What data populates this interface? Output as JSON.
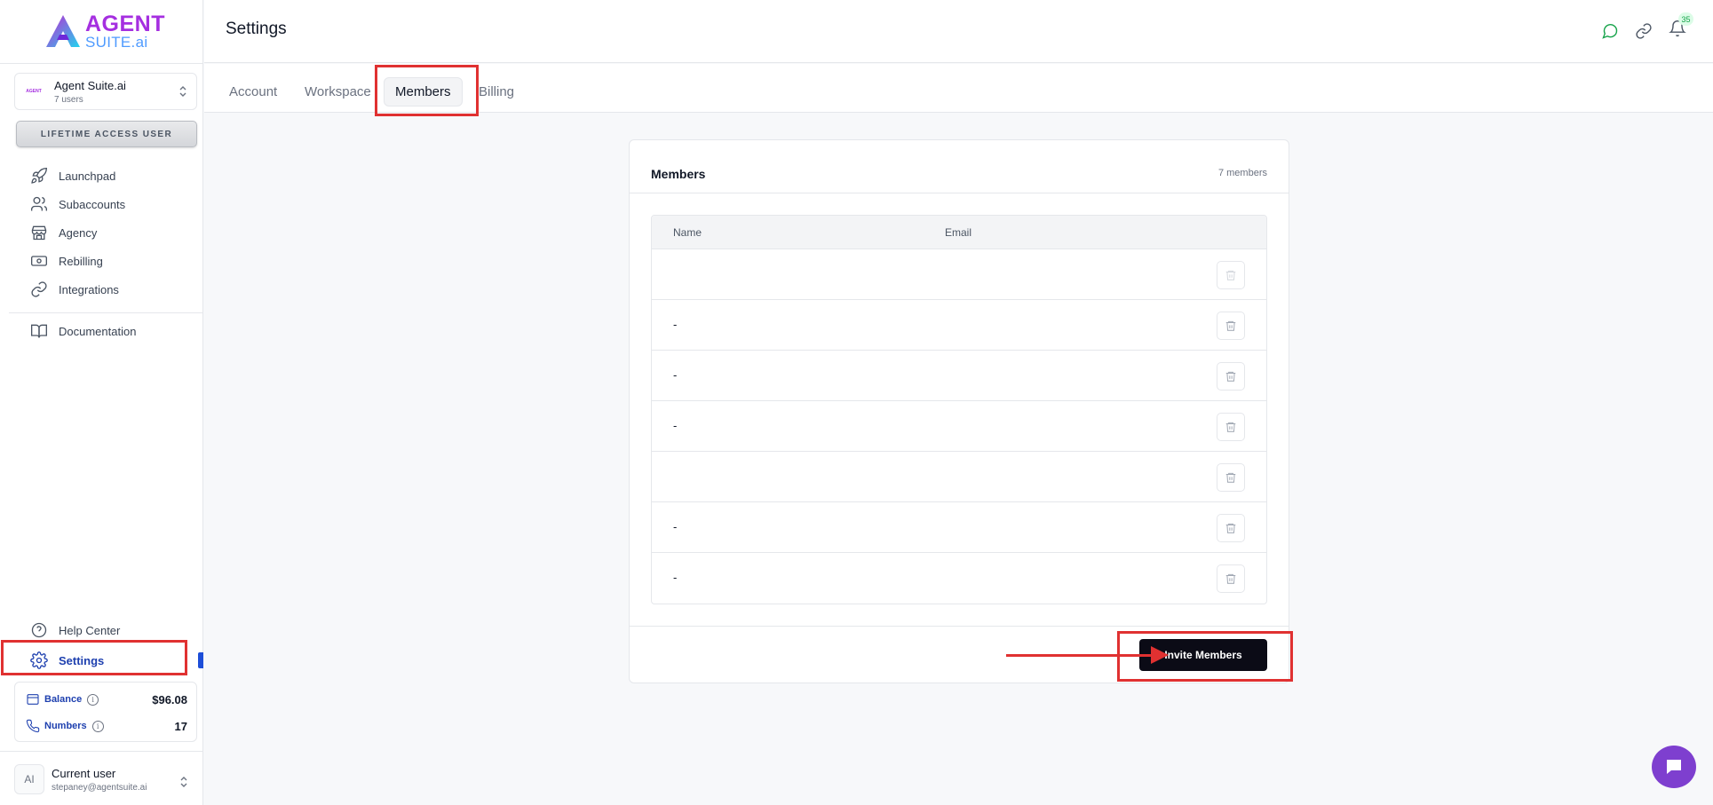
{
  "brand": {
    "line1": "AGENT",
    "line2": "SUITE.ai"
  },
  "account": {
    "name": "Agent Suite.ai",
    "users": "7 users",
    "mini_logo": "AGENT"
  },
  "lifetime_label": "LIFETIME ACCESS USER",
  "nav": {
    "items": [
      {
        "label": "Launchpad",
        "icon": "rocket-icon"
      },
      {
        "label": "Subaccounts",
        "icon": "users-icon"
      },
      {
        "label": "Agency",
        "icon": "store-icon"
      },
      {
        "label": "Rebilling",
        "icon": "banknote-icon"
      },
      {
        "label": "Integrations",
        "icon": "link-icon"
      }
    ],
    "documentation": "Documentation",
    "help": "Help Center",
    "settings": "Settings"
  },
  "balance": {
    "label": "Balance",
    "value": "$96.08"
  },
  "numbers": {
    "label": "Numbers",
    "value": "17"
  },
  "user": {
    "initials": "AI",
    "name": "Current user",
    "email": "stepaney@agentsuite.ai"
  },
  "header": {
    "title": "Settings",
    "notification_count": "35"
  },
  "tabs": [
    {
      "label": "Account"
    },
    {
      "label": "Workspace"
    },
    {
      "label": "Members",
      "active": true
    },
    {
      "label": "Billing"
    }
  ],
  "members_card": {
    "title": "Members",
    "count": "7 members",
    "columns": {
      "name": "Name",
      "email": "Email"
    },
    "rows": [
      {
        "name": "",
        "email": ""
      },
      {
        "name": "-",
        "email": ""
      },
      {
        "name": "-",
        "email": ""
      },
      {
        "name": "-",
        "email": ""
      },
      {
        "name": "",
        "email": ""
      },
      {
        "name": "-",
        "email": ""
      },
      {
        "name": "-",
        "email": ""
      }
    ],
    "invite_label": "Invite Members"
  },
  "colors": {
    "accent": "#1e40af",
    "brand_purple": "#a52fe0",
    "highlight": "#e03131",
    "chat": "#7e3fcf"
  }
}
